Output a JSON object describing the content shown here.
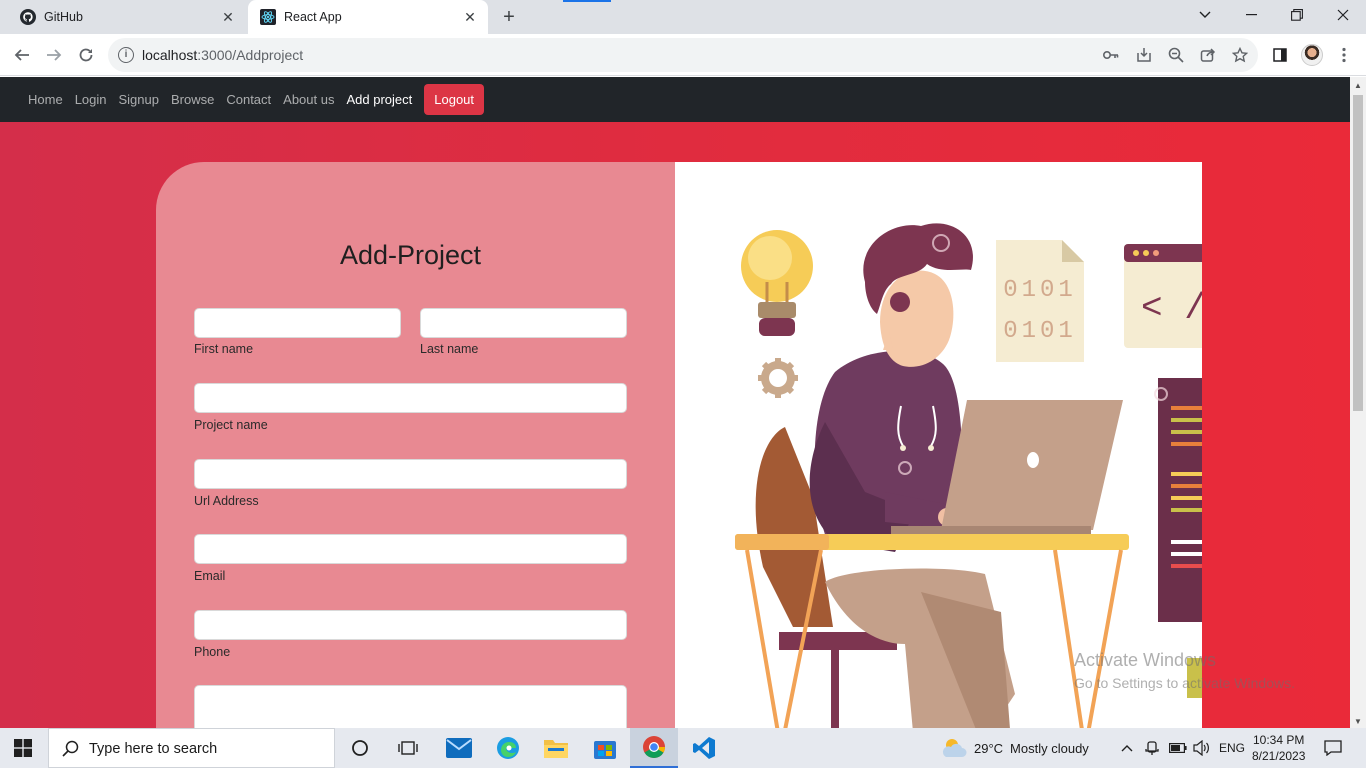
{
  "browser": {
    "tabs": [
      {
        "title": "GitHub",
        "active": false
      },
      {
        "title": "React App",
        "active": true
      }
    ],
    "url_host": "localhost",
    "url_rest": ":3000/Addproject",
    "window_controls": [
      "minimize",
      "restore",
      "close"
    ]
  },
  "navbar": {
    "links": [
      "Home",
      "Login",
      "Signup",
      "Browse",
      "Contact",
      "About us",
      "Add project"
    ],
    "active_link": "Add project",
    "logout_label": "Logout"
  },
  "form": {
    "title": "Add-Project",
    "labels": {
      "first_name": "First name",
      "last_name": "Last name",
      "project_name": "Project name",
      "url_address": "Url Address",
      "email": "Email",
      "phone": "Phone"
    },
    "values": {
      "first_name": "",
      "last_name": "",
      "project_name": "",
      "url_address": "",
      "email": "",
      "phone": "",
      "description": ""
    }
  },
  "illustration": {
    "binary_line_1": "0101",
    "binary_line_2": "0101",
    "code_tag": "< /"
  },
  "watermark": {
    "line1": "Activate Windows",
    "line2": "Go to Settings to activate Windows."
  },
  "taskbar": {
    "search_placeholder": "Type here to search",
    "weather_temp": "29°C",
    "weather_desc": "Mostly cloudy",
    "language": "ENG",
    "time": "10:34 PM",
    "date": "8/21/2023"
  },
  "colors": {
    "page_gradient_start": "#d42e4a",
    "page_gradient_end": "#ea2a39",
    "navbar_bg": "#212529",
    "logout_bg": "#dc3545",
    "form_panel_bg": "#e88992"
  }
}
